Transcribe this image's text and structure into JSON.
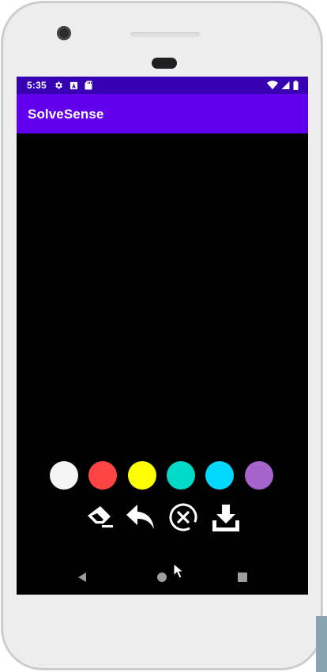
{
  "status_bar": {
    "time": "5:35",
    "left_icons": [
      "settings-icon",
      "keyboard-a-icon",
      "sd-card-icon"
    ],
    "right_icons": [
      "wifi-icon",
      "cell-signal-icon",
      "battery-icon"
    ],
    "background": "#3700b3"
  },
  "app_bar": {
    "title": "SolveSense",
    "background": "#6200ee"
  },
  "canvas": {
    "background": "#000000"
  },
  "palette": {
    "colors": [
      "#f5f5f5",
      "#ff4444",
      "#ffff00",
      "#00d9c8",
      "#00d8ff",
      "#a663cc"
    ]
  },
  "tools": [
    "eraser-icon",
    "undo-icon",
    "clear-icon",
    "save-icon"
  ],
  "nav_bar": {
    "buttons": [
      "back-icon",
      "home-icon",
      "recents-icon"
    ]
  }
}
